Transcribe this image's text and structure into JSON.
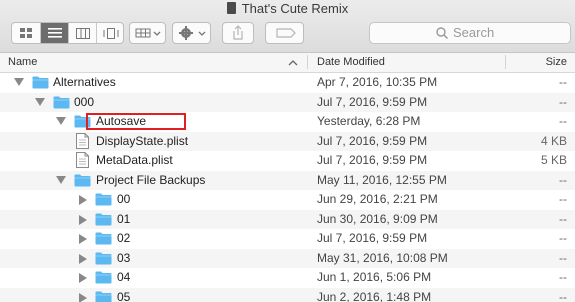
{
  "window": {
    "title": "That's Cute Remix",
    "title_icon": "document-icon"
  },
  "toolbar": {
    "view_buttons": [
      "icon-view",
      "list-view",
      "column-view",
      "cover-flow-view"
    ],
    "active_view": "list-view",
    "search_placeholder": "Search"
  },
  "columns": {
    "name": "Name",
    "date": "Date Modified",
    "size": "Size"
  },
  "rows": [
    {
      "name": "Alternatives",
      "date": "Apr 7, 2016, 10:35 PM",
      "size": "--",
      "kind": "folder",
      "indent": 0,
      "disclosure": "down"
    },
    {
      "name": "000",
      "date": "Jul 7, 2016, 9:59 PM",
      "size": "--",
      "kind": "folder",
      "indent": 1,
      "disclosure": "down"
    },
    {
      "name": "Autosave",
      "date": "Yesterday, 6:28 PM",
      "size": "--",
      "kind": "folder",
      "indent": 2,
      "disclosure": "down",
      "highlighted": true
    },
    {
      "name": "DisplayState.plist",
      "date": "Jul 7, 2016, 9:59 PM",
      "size": "4 KB",
      "kind": "file",
      "indent": 2,
      "disclosure": "none"
    },
    {
      "name": "MetaData.plist",
      "date": "Jul 7, 2016, 9:59 PM",
      "size": "5 KB",
      "kind": "file",
      "indent": 2,
      "disclosure": "none"
    },
    {
      "name": "Project File Backups",
      "date": "May 11, 2016, 12:55 PM",
      "size": "--",
      "kind": "folder",
      "indent": 2,
      "disclosure": "down"
    },
    {
      "name": "00",
      "date": "Jun 29, 2016, 2:21 PM",
      "size": "--",
      "kind": "folder",
      "indent": 3,
      "disclosure": "right"
    },
    {
      "name": "01",
      "date": "Jun 30, 2016, 9:09 PM",
      "size": "--",
      "kind": "folder",
      "indent": 3,
      "disclosure": "right"
    },
    {
      "name": "02",
      "date": "Jul 7, 2016, 9:59 PM",
      "size": "--",
      "kind": "folder",
      "indent": 3,
      "disclosure": "right"
    },
    {
      "name": "03",
      "date": "May 31, 2016, 10:08 PM",
      "size": "--",
      "kind": "folder",
      "indent": 3,
      "disclosure": "right"
    },
    {
      "name": "04",
      "date": "Jun 1, 2016, 5:06 PM",
      "size": "--",
      "kind": "folder",
      "indent": 3,
      "disclosure": "right"
    },
    {
      "name": "05",
      "date": "Jun 2, 2016, 1:48 PM",
      "size": "--",
      "kind": "folder",
      "indent": 3,
      "disclosure": "right"
    }
  ],
  "colors": {
    "folder": "#5bb8f0",
    "highlight_box": "#e02020"
  }
}
